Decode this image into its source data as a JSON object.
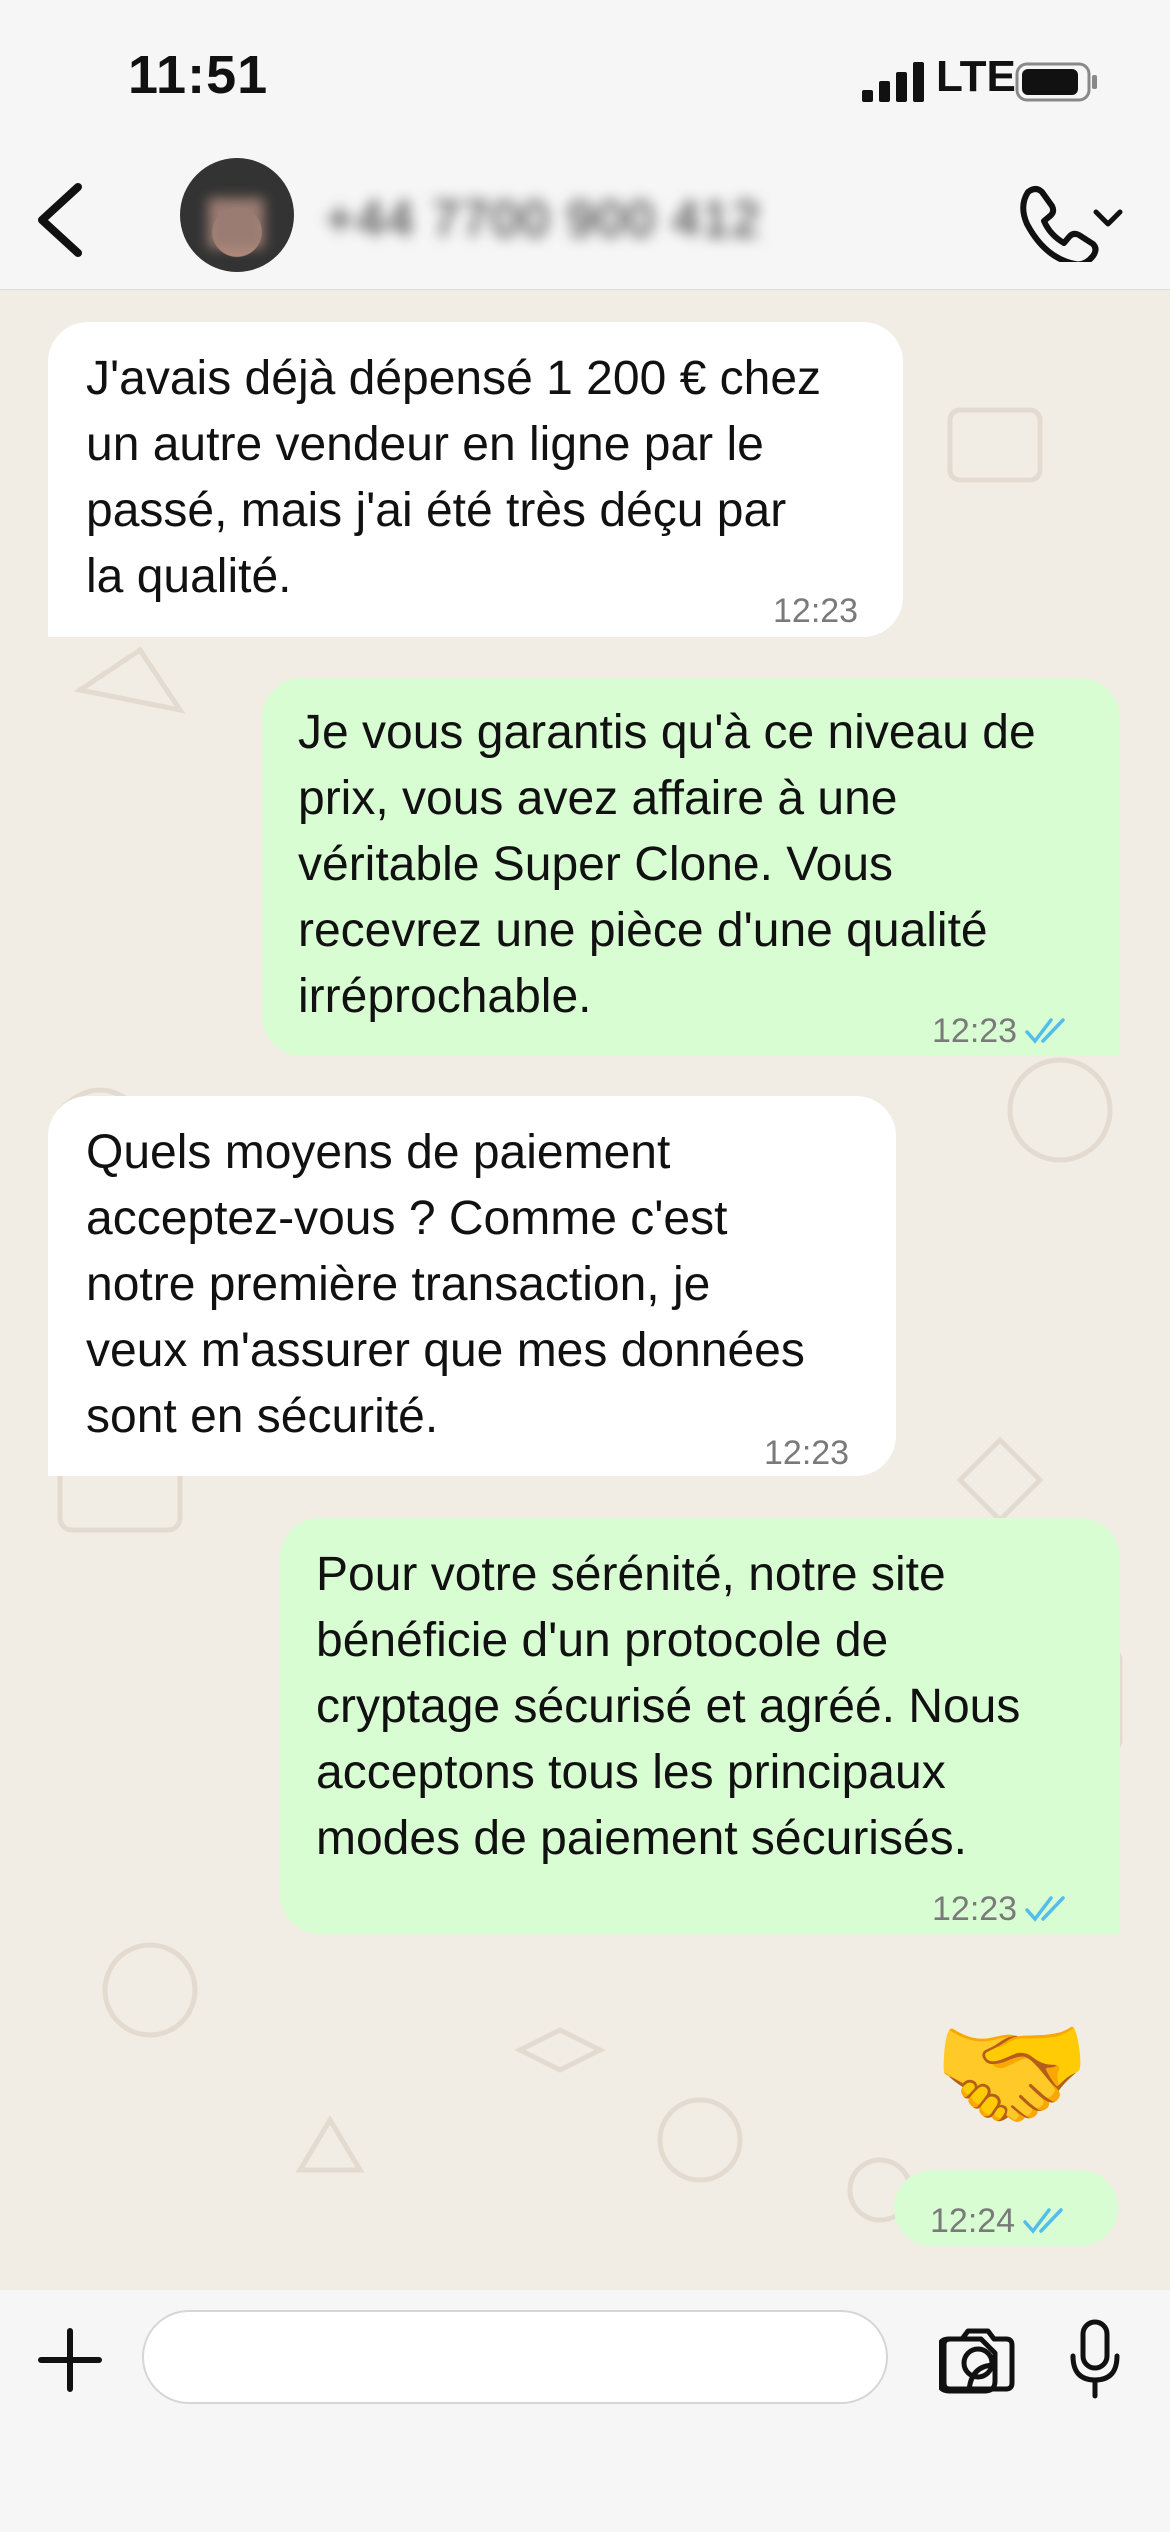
{
  "status_bar": {
    "time": "11:51",
    "network": "LTE",
    "signal_bars": 4,
    "battery_level": 0.9
  },
  "header": {
    "contact_name": "+44 7700 900 412",
    "back_icon": "chevron-left-icon",
    "call_icon": "phone-icon"
  },
  "messages": [
    {
      "direction": "incoming",
      "text": "J'avais déjà dépensé 1 200 € chez\nun autre vendeur en ligne par le\npassé, mais j'ai été très déçu par\nla qualité.",
      "time": "12:23"
    },
    {
      "direction": "outgoing",
      "text": "Je vous garantis qu'à ce niveau de\nprix, vous avez affaire à une\nvéritable Super Clone. Vous\nrecevrez une pièce d'une qualité\nirréprochable.",
      "time": "12:23",
      "status": "read"
    },
    {
      "direction": "incoming",
      "text": "Quels moyens de paiement\nacceptez-vous ? Comme c'est\nnotre première transaction, je\nveux m'assurer que mes données\nsont en sécurité.",
      "time": "12:23"
    },
    {
      "direction": "outgoing",
      "text": "Pour votre sérénité, notre site\nbénéficie d'un protocole de\ncryptage sécurisé et agréé. Nous\nacceptons tous les principaux\nmodes de paiement sécurisés.",
      "time": "12:23",
      "status": "read"
    },
    {
      "direction": "outgoing",
      "emoji": "🤝",
      "time": "12:24",
      "status": "read"
    }
  ],
  "composer": {
    "value": "",
    "placeholder": "",
    "icons": [
      "plus-icon",
      "sticker-icon",
      "camera-icon",
      "microphone-icon"
    ]
  },
  "colors": {
    "incoming_bubble": "#ffffff",
    "outgoing_bubble": "#d9fdd3",
    "read_ticks": "#53bdeb",
    "wallpaper": "#f1ece4"
  }
}
